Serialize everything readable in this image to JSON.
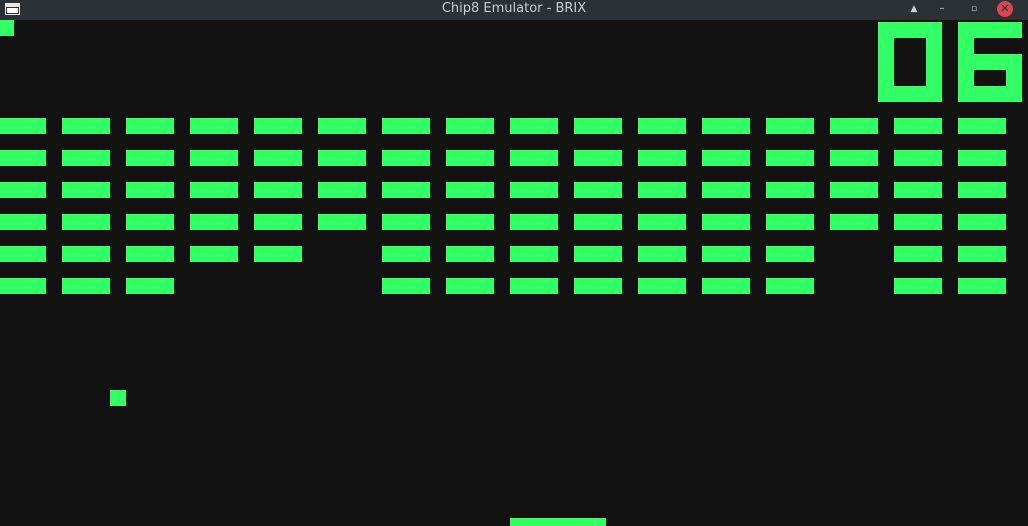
{
  "window": {
    "title": "Chip8 Emulator - BRIX",
    "controls": [
      "keep-above",
      "minimize",
      "maximize",
      "close"
    ]
  },
  "colors": {
    "foreground": "#33ff66",
    "background": "#121212",
    "titlebar": "#2c3136",
    "close": "#da4453"
  },
  "game": {
    "name": "BRIX",
    "score": "06",
    "lives_shown": 1,
    "brick_grid": {
      "rows": [
        [
          1,
          1,
          1,
          1,
          1,
          1,
          1,
          1,
          1,
          1,
          1,
          1,
          1,
          1,
          1,
          1
        ],
        [
          1,
          1,
          1,
          1,
          1,
          1,
          1,
          1,
          1,
          1,
          1,
          1,
          1,
          1,
          1,
          1
        ],
        [
          1,
          1,
          1,
          1,
          1,
          1,
          1,
          1,
          1,
          1,
          1,
          1,
          1,
          1,
          1,
          1
        ],
        [
          1,
          1,
          1,
          1,
          1,
          1,
          1,
          1,
          1,
          1,
          1,
          1,
          1,
          1,
          1,
          1
        ],
        [
          1,
          1,
          1,
          1,
          1,
          0,
          1,
          1,
          1,
          1,
          1,
          1,
          1,
          0,
          1,
          1
        ],
        [
          1,
          1,
          1,
          0,
          0,
          0,
          1,
          1,
          1,
          1,
          1,
          1,
          1,
          0,
          1,
          1
        ]
      ]
    }
  }
}
